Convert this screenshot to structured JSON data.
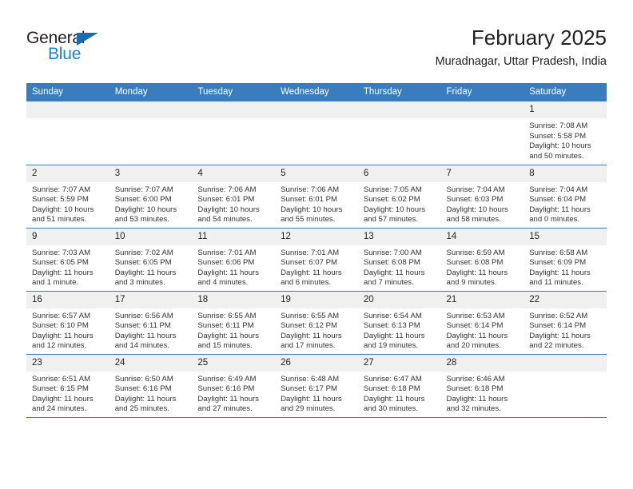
{
  "brand": {
    "name_part1": "General",
    "name_part2": "Blue",
    "logo_icon": "triangle-mark",
    "color_blue": "#1d7fd0",
    "color_dark": "#231f20"
  },
  "header": {
    "title": "February 2025",
    "subtitle": "Muradnagar, Uttar Pradesh, India"
  },
  "theme": {
    "header_bar": "#3a7dbe",
    "daynum_band": "#f0f0f0",
    "row_rule": "#3a7dbe",
    "text": "#222222"
  },
  "calendar": {
    "weekday_headers": [
      "Sunday",
      "Monday",
      "Tuesday",
      "Wednesday",
      "Thursday",
      "Friday",
      "Saturday"
    ],
    "weeks": [
      [
        {
          "day": "",
          "sunrise": "",
          "sunset": "",
          "daylight_line1": "",
          "daylight_line2": ""
        },
        {
          "day": "",
          "sunrise": "",
          "sunset": "",
          "daylight_line1": "",
          "daylight_line2": ""
        },
        {
          "day": "",
          "sunrise": "",
          "sunset": "",
          "daylight_line1": "",
          "daylight_line2": ""
        },
        {
          "day": "",
          "sunrise": "",
          "sunset": "",
          "daylight_line1": "",
          "daylight_line2": ""
        },
        {
          "day": "",
          "sunrise": "",
          "sunset": "",
          "daylight_line1": "",
          "daylight_line2": ""
        },
        {
          "day": "",
          "sunrise": "",
          "sunset": "",
          "daylight_line1": "",
          "daylight_line2": ""
        },
        {
          "day": "1",
          "sunrise": "Sunrise: 7:08 AM",
          "sunset": "Sunset: 5:58 PM",
          "daylight_line1": "Daylight: 10 hours",
          "daylight_line2": "and 50 minutes."
        }
      ],
      [
        {
          "day": "2",
          "sunrise": "Sunrise: 7:07 AM",
          "sunset": "Sunset: 5:59 PM",
          "daylight_line1": "Daylight: 10 hours",
          "daylight_line2": "and 51 minutes."
        },
        {
          "day": "3",
          "sunrise": "Sunrise: 7:07 AM",
          "sunset": "Sunset: 6:00 PM",
          "daylight_line1": "Daylight: 10 hours",
          "daylight_line2": "and 53 minutes."
        },
        {
          "day": "4",
          "sunrise": "Sunrise: 7:06 AM",
          "sunset": "Sunset: 6:01 PM",
          "daylight_line1": "Daylight: 10 hours",
          "daylight_line2": "and 54 minutes."
        },
        {
          "day": "5",
          "sunrise": "Sunrise: 7:06 AM",
          "sunset": "Sunset: 6:01 PM",
          "daylight_line1": "Daylight: 10 hours",
          "daylight_line2": "and 55 minutes."
        },
        {
          "day": "6",
          "sunrise": "Sunrise: 7:05 AM",
          "sunset": "Sunset: 6:02 PM",
          "daylight_line1": "Daylight: 10 hours",
          "daylight_line2": "and 57 minutes."
        },
        {
          "day": "7",
          "sunrise": "Sunrise: 7:04 AM",
          "sunset": "Sunset: 6:03 PM",
          "daylight_line1": "Daylight: 10 hours",
          "daylight_line2": "and 58 minutes."
        },
        {
          "day": "8",
          "sunrise": "Sunrise: 7:04 AM",
          "sunset": "Sunset: 6:04 PM",
          "daylight_line1": "Daylight: 11 hours",
          "daylight_line2": "and 0 minutes."
        }
      ],
      [
        {
          "day": "9",
          "sunrise": "Sunrise: 7:03 AM",
          "sunset": "Sunset: 6:05 PM",
          "daylight_line1": "Daylight: 11 hours",
          "daylight_line2": "and 1 minute."
        },
        {
          "day": "10",
          "sunrise": "Sunrise: 7:02 AM",
          "sunset": "Sunset: 6:05 PM",
          "daylight_line1": "Daylight: 11 hours",
          "daylight_line2": "and 3 minutes."
        },
        {
          "day": "11",
          "sunrise": "Sunrise: 7:01 AM",
          "sunset": "Sunset: 6:06 PM",
          "daylight_line1": "Daylight: 11 hours",
          "daylight_line2": "and 4 minutes."
        },
        {
          "day": "12",
          "sunrise": "Sunrise: 7:01 AM",
          "sunset": "Sunset: 6:07 PM",
          "daylight_line1": "Daylight: 11 hours",
          "daylight_line2": "and 6 minutes."
        },
        {
          "day": "13",
          "sunrise": "Sunrise: 7:00 AM",
          "sunset": "Sunset: 6:08 PM",
          "daylight_line1": "Daylight: 11 hours",
          "daylight_line2": "and 7 minutes."
        },
        {
          "day": "14",
          "sunrise": "Sunrise: 6:59 AM",
          "sunset": "Sunset: 6:08 PM",
          "daylight_line1": "Daylight: 11 hours",
          "daylight_line2": "and 9 minutes."
        },
        {
          "day": "15",
          "sunrise": "Sunrise: 6:58 AM",
          "sunset": "Sunset: 6:09 PM",
          "daylight_line1": "Daylight: 11 hours",
          "daylight_line2": "and 11 minutes."
        }
      ],
      [
        {
          "day": "16",
          "sunrise": "Sunrise: 6:57 AM",
          "sunset": "Sunset: 6:10 PM",
          "daylight_line1": "Daylight: 11 hours",
          "daylight_line2": "and 12 minutes."
        },
        {
          "day": "17",
          "sunrise": "Sunrise: 6:56 AM",
          "sunset": "Sunset: 6:11 PM",
          "daylight_line1": "Daylight: 11 hours",
          "daylight_line2": "and 14 minutes."
        },
        {
          "day": "18",
          "sunrise": "Sunrise: 6:55 AM",
          "sunset": "Sunset: 6:11 PM",
          "daylight_line1": "Daylight: 11 hours",
          "daylight_line2": "and 15 minutes."
        },
        {
          "day": "19",
          "sunrise": "Sunrise: 6:55 AM",
          "sunset": "Sunset: 6:12 PM",
          "daylight_line1": "Daylight: 11 hours",
          "daylight_line2": "and 17 minutes."
        },
        {
          "day": "20",
          "sunrise": "Sunrise: 6:54 AM",
          "sunset": "Sunset: 6:13 PM",
          "daylight_line1": "Daylight: 11 hours",
          "daylight_line2": "and 19 minutes."
        },
        {
          "day": "21",
          "sunrise": "Sunrise: 6:53 AM",
          "sunset": "Sunset: 6:14 PM",
          "daylight_line1": "Daylight: 11 hours",
          "daylight_line2": "and 20 minutes."
        },
        {
          "day": "22",
          "sunrise": "Sunrise: 6:52 AM",
          "sunset": "Sunset: 6:14 PM",
          "daylight_line1": "Daylight: 11 hours",
          "daylight_line2": "and 22 minutes."
        }
      ],
      [
        {
          "day": "23",
          "sunrise": "Sunrise: 6:51 AM",
          "sunset": "Sunset: 6:15 PM",
          "daylight_line1": "Daylight: 11 hours",
          "daylight_line2": "and 24 minutes."
        },
        {
          "day": "24",
          "sunrise": "Sunrise: 6:50 AM",
          "sunset": "Sunset: 6:16 PM",
          "daylight_line1": "Daylight: 11 hours",
          "daylight_line2": "and 25 minutes."
        },
        {
          "day": "25",
          "sunrise": "Sunrise: 6:49 AM",
          "sunset": "Sunset: 6:16 PM",
          "daylight_line1": "Daylight: 11 hours",
          "daylight_line2": "and 27 minutes."
        },
        {
          "day": "26",
          "sunrise": "Sunrise: 6:48 AM",
          "sunset": "Sunset: 6:17 PM",
          "daylight_line1": "Daylight: 11 hours",
          "daylight_line2": "and 29 minutes."
        },
        {
          "day": "27",
          "sunrise": "Sunrise: 6:47 AM",
          "sunset": "Sunset: 6:18 PM",
          "daylight_line1": "Daylight: 11 hours",
          "daylight_line2": "and 30 minutes."
        },
        {
          "day": "28",
          "sunrise": "Sunrise: 6:46 AM",
          "sunset": "Sunset: 6:18 PM",
          "daylight_line1": "Daylight: 11 hours",
          "daylight_line2": "and 32 minutes."
        },
        {
          "day": "",
          "sunrise": "",
          "sunset": "",
          "daylight_line1": "",
          "daylight_line2": ""
        }
      ]
    ]
  }
}
